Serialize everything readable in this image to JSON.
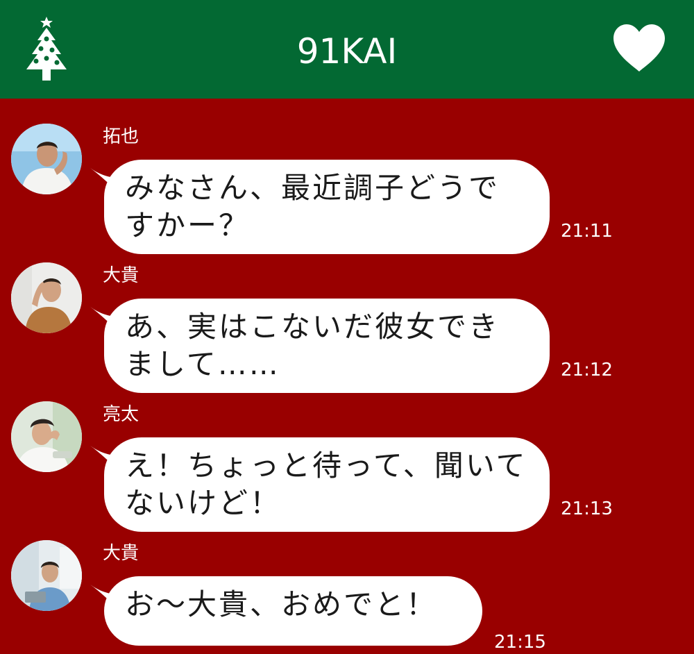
{
  "header": {
    "title": "91KAI",
    "left_icon": "christmas-tree-icon",
    "right_icon": "heart-icon",
    "background_color": "#036933"
  },
  "chat": {
    "background_color": "#990000",
    "messages": [
      {
        "sender": "拓也",
        "text": "みなさん、最近調子どうですかー？",
        "time": "21:11"
      },
      {
        "sender": "大貴",
        "text": "あ、実はこないだ彼女できまして……",
        "time": "21:12"
      },
      {
        "sender": "亮太",
        "text": "え！ちょっと待って、聞いてないけど！",
        "time": "21:13"
      },
      {
        "sender": "大貴",
        "text": "お～大貴、おめでと！",
        "time": "21:15"
      }
    ]
  }
}
